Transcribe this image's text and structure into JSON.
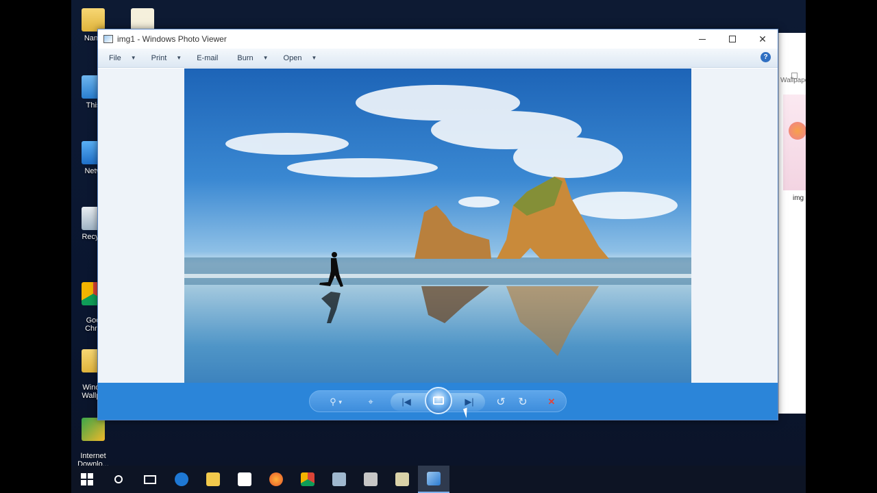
{
  "desktop": {
    "icons": [
      {
        "label": "Nano",
        "icon": "folder-icon"
      },
      {
        "label": "This",
        "icon": "this-pc-icon"
      },
      {
        "label": "Netw",
        "icon": "network-icon"
      },
      {
        "label": "Recycl",
        "icon": "recycle-bin-icon"
      },
      {
        "label": "Goo\nChro",
        "icon": "chrome-icon"
      },
      {
        "label": "Windo\nWallpa",
        "icon": "folder-icon"
      },
      {
        "label": "Internet\nDownlo...",
        "icon": "idm-icon"
      }
    ]
  },
  "background_window": {
    "breadcrumb": "Wallpape",
    "file_caption": "img"
  },
  "viewer": {
    "title": "img1 - Windows Photo Viewer",
    "menu": [
      {
        "label": "File",
        "has_arrow": true
      },
      {
        "label": "Print",
        "has_arrow": true
      },
      {
        "label": "E-mail",
        "has_arrow": false
      },
      {
        "label": "Burn",
        "has_arrow": true
      },
      {
        "label": "Open",
        "has_arrow": true
      }
    ],
    "help_glyph": "?",
    "controls": {
      "zoom": "⚲",
      "actual_size": "⌖",
      "previous": "|◀",
      "next": "▶|",
      "rotate_ccw": "↺",
      "rotate_cw": "↻",
      "delete": "✕"
    }
  },
  "taskbar": {
    "apps": [
      "start",
      "search",
      "task-view",
      "edge",
      "file-explorer",
      "store",
      "firefox",
      "chrome",
      "app",
      "app",
      "app",
      "photo-viewer"
    ],
    "active": "photo-viewer"
  }
}
